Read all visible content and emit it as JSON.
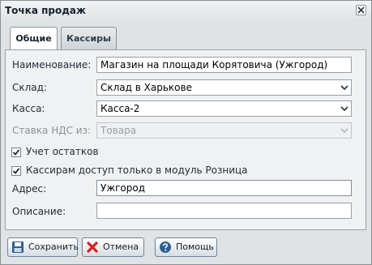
{
  "window": {
    "title": "Точка продаж"
  },
  "tabs": [
    {
      "label": "Общие"
    },
    {
      "label": "Кассиры"
    }
  ],
  "form": {
    "name": {
      "label": "Наименование:",
      "value": "Магазин на площади Корятовича (Ужгород)"
    },
    "warehouse": {
      "label": "Склад:",
      "value": "Склад в Харькове"
    },
    "cashbox": {
      "label": "Касса:",
      "value": "Касса-2"
    },
    "vat": {
      "label": "Ставка НДС из:",
      "value": "Товара"
    },
    "stock_tracking": {
      "label": "Учет остатков",
      "checked": true
    },
    "retail_only": {
      "label": "Кассирам доступ только в модуль Розница",
      "checked": true
    },
    "address": {
      "label": "Адрес:",
      "value": "Ужгород"
    },
    "description": {
      "label": "Описание:",
      "value": ""
    }
  },
  "buttons": {
    "save": "Сохранить",
    "cancel": "Отмена",
    "help": "Помощь"
  },
  "icons": {
    "close": "close-icon",
    "save": "floppy-disk-icon",
    "cancel": "red-x-icon",
    "help": "question-mark-icon"
  },
  "colors": {
    "accent": "#2b5f8e",
    "cancel_red": "#d62020"
  }
}
